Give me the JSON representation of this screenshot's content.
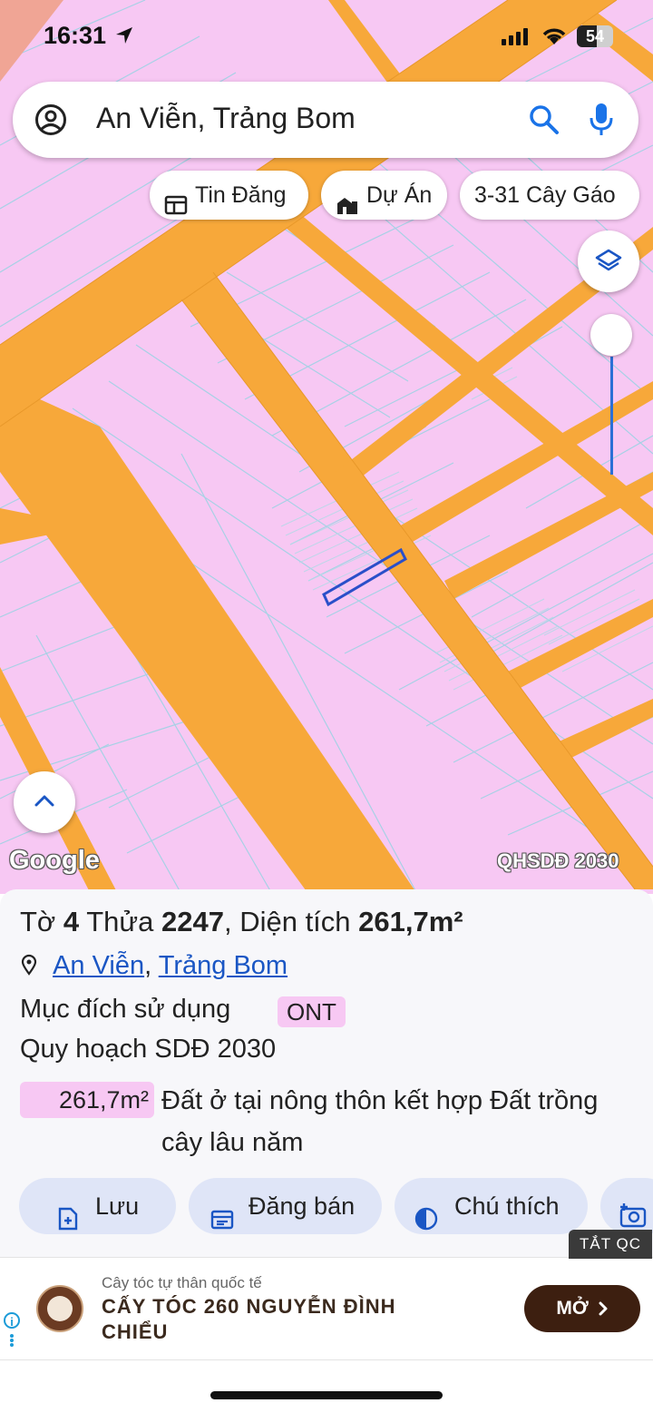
{
  "status_bar": {
    "time": "16:31",
    "battery": "54"
  },
  "search": {
    "query": "An Viễn, Trảng Bom"
  },
  "chips": [
    {
      "label": "Tin Đăng",
      "icon": "table-icon"
    },
    {
      "label": "Dự Án",
      "icon": "building-icon"
    },
    {
      "label": "3-31 Cây Gáo",
      "icon": ""
    }
  ],
  "map": {
    "attribution": "Google",
    "overlay_label": "QHSDĐ 2030",
    "colors": {
      "land": "#f7c8f3",
      "road": "#f7a83a",
      "parcel_line": "#9fd2e4",
      "selected_parcel": "#2a4fc9"
    }
  },
  "parcel": {
    "title_sheet_label": "Tờ",
    "sheet": "4",
    "title_parcel_label": "Thửa",
    "parcel_no": "2247",
    "area_label": ", Diện tích",
    "area": "261,7m²",
    "commune": "An Viễn",
    "district": "Trảng Bom",
    "separator": ",",
    "purpose_label": "Mục đích sử dụng",
    "purpose_code": "ONT",
    "plan_label": "Quy hoạch SDĐ 2030",
    "plan_area": "261,7m²",
    "plan_desc": "Đất ở tại nông thôn kết hợp Đất trồng cây lâu năm"
  },
  "actions": [
    {
      "label": "Lưu",
      "icon": "save-add-icon"
    },
    {
      "label": "Đăng bán",
      "icon": "post-icon"
    },
    {
      "label": "Chú thích",
      "icon": "legend-icon"
    },
    {
      "label": "",
      "icon": "camera-icon"
    }
  ],
  "ad": {
    "close_label": "TẮT QC",
    "subtitle": "Cây tóc tự thân quốc tế",
    "headline": "CẤY TÓC 260 NGUYỄN ĐÌNH CHIỂU",
    "cta": "MỞ"
  }
}
